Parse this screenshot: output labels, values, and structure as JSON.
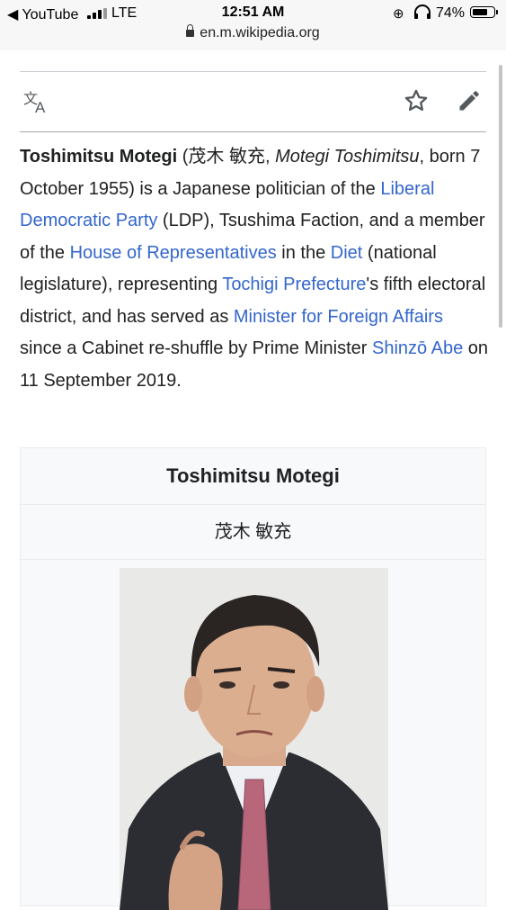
{
  "status_bar": {
    "back_app": "◀ YouTube",
    "network": "LTE",
    "time": "12:51 AM",
    "url": "en.m.wikipedia.org",
    "battery_percent": "74%",
    "battery_level": 0.74
  },
  "toolbar": {
    "language_icon": "translate-icon",
    "watch_icon": "star-icon",
    "edit_icon": "pencil-icon"
  },
  "article": {
    "name": "Toshimitsu Motegi",
    "p1": " (茂木 敏充, ",
    "romaji": "Motegi Toshimitsu",
    "p2": ", born 7 October 1955) is a Japanese politician of the ",
    "link_ldp": "Liberal Democratic Party",
    "p3": " (LDP), Tsushima Faction, and a member of the ",
    "link_house": "House of Representatives",
    "p4": " in the ",
    "link_diet": "Diet",
    "p5": " (national legislature), representing ",
    "link_tochigi": "Tochigi Prefecture",
    "p6": "'s fifth electoral district, and has served as ",
    "link_minister": "Minister for Foreign Affairs",
    "p7": " since a Cabinet re-shuffle by Prime Minister ",
    "link_abe": "Shinzō Abe",
    "p8": " on 11 September 2019."
  },
  "infobox": {
    "title": "Toshimitsu Motegi",
    "native_name": "茂木 敏充"
  },
  "colors": {
    "link": "#3366cc",
    "text": "#202122",
    "icon": "#54595d"
  }
}
